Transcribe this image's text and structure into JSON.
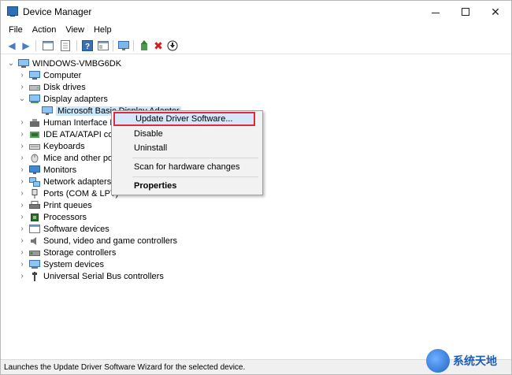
{
  "window": {
    "title": "Device Manager"
  },
  "menubar": [
    "File",
    "Action",
    "View",
    "Help"
  ],
  "tree": {
    "root": "WINDOWS-VMBG6DK",
    "items": [
      {
        "label": "Computer",
        "icon": "computer-icon",
        "expanded": false
      },
      {
        "label": "Disk drives",
        "icon": "disk-drive-icon",
        "expanded": false
      },
      {
        "label": "Display adapters",
        "icon": "display-adapter-icon",
        "expanded": true
      },
      {
        "label": "Microsoft Basic Display Adapter",
        "icon": "monitor-icon",
        "child": true
      },
      {
        "label": "Human Interface De",
        "icon": "hid-icon",
        "expanded": false
      },
      {
        "label": "IDE ATA/ATAPI con",
        "icon": "ide-icon",
        "expanded": false
      },
      {
        "label": "Keyboards",
        "icon": "keyboard-icon",
        "expanded": false
      },
      {
        "label": "Mice and other poi",
        "icon": "mouse-icon",
        "expanded": false
      },
      {
        "label": "Monitors",
        "icon": "monitor-icon",
        "expanded": false
      },
      {
        "label": "Network adapters",
        "icon": "network-icon",
        "expanded": false
      },
      {
        "label": "Ports (COM & LPT)",
        "icon": "port-icon",
        "expanded": false
      },
      {
        "label": "Print queues",
        "icon": "printer-icon",
        "expanded": false
      },
      {
        "label": "Processors",
        "icon": "processor-icon",
        "expanded": false
      },
      {
        "label": "Software devices",
        "icon": "software-device-icon",
        "expanded": false
      },
      {
        "label": "Sound, video and game controllers",
        "icon": "speaker-icon",
        "expanded": false
      },
      {
        "label": "Storage controllers",
        "icon": "storage-icon",
        "expanded": false
      },
      {
        "label": "System devices",
        "icon": "system-icon",
        "expanded": false
      },
      {
        "label": "Universal Serial Bus controllers",
        "icon": "usb-icon",
        "expanded": false
      }
    ]
  },
  "context_menu": {
    "update": "Update Driver Software...",
    "disable": "Disable",
    "uninstall": "Uninstall",
    "scan": "Scan for hardware changes",
    "properties": "Properties"
  },
  "statusbar": {
    "text": "Launches the Update Driver Software Wizard for the selected device."
  },
  "watermark": {
    "text": "系统天地"
  },
  "colors": {
    "highlight_border": "#e0293e",
    "selection": "#cce8ff",
    "menu_bg": "#f2f2f2"
  }
}
